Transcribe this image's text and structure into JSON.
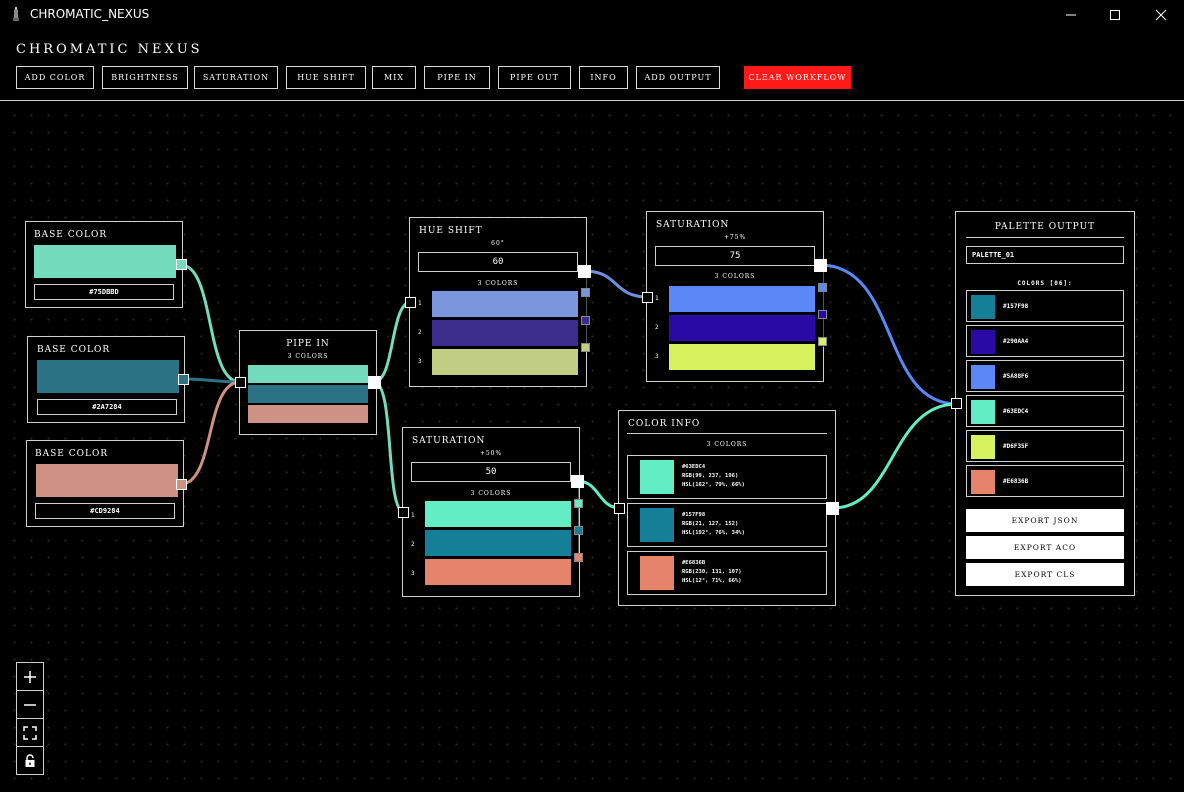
{
  "window": {
    "title": "CHROMATIC_NEXUS"
  },
  "app": {
    "brand": "CHROMATIC NEXUS"
  },
  "toolbar": {
    "add_color": "ADD COLOR",
    "brightness": "BRIGHTNESS",
    "saturation": "SATURATION",
    "hue_shift": "HUE SHIFT",
    "mix": "MIX",
    "pipe_in": "PIPE IN",
    "pipe_out": "PIPE OUT",
    "info": "INFO",
    "add_output": "ADD OUTPUT",
    "clear_workflow": "CLEAR WORKFLOW"
  },
  "colors": {
    "danger": "#ff1a1a",
    "wire_teal": "#63e0b8",
    "wire_blue": "#5a7ee0",
    "wire_pink": "#d58a80"
  },
  "nodes": {
    "base1": {
      "title": "BASE COLOR",
      "hex": "#75DBBD",
      "color": "#75dbbd"
    },
    "base2": {
      "title": "BASE COLOR",
      "hex": "#2A7284",
      "color": "#2a7284"
    },
    "base3": {
      "title": "BASE COLOR",
      "hex": "#CD9284",
      "color": "#cd9284"
    },
    "pipe_in": {
      "title": "PIPE IN",
      "sub": "3 COLORS",
      "swatches": [
        "#75dbbd",
        "#2a7284",
        "#cd9284"
      ]
    },
    "hue": {
      "title": "HUE SHIFT",
      "amount": "60°",
      "value": "60",
      "count": "3 COLORS",
      "rows": [
        {
          "n": "1",
          "color": "#7b95de"
        },
        {
          "n": "2",
          "color": "#3c2d8c"
        },
        {
          "n": "3",
          "color": "#c2cd84"
        }
      ]
    },
    "sat_top": {
      "title": "SATURATION",
      "amount": "+75%",
      "value": "75",
      "count": "3 COLORS",
      "rows": [
        {
          "n": "1",
          "color": "#5a88f6"
        },
        {
          "n": "2",
          "color": "#290aa4"
        },
        {
          "n": "3",
          "color": "#d6f35f"
        }
      ]
    },
    "sat_bot": {
      "title": "SATURATION",
      "amount": "+50%",
      "value": "50",
      "count": "3 COLORS",
      "rows": [
        {
          "n": "1",
          "color": "#63edc4"
        },
        {
          "n": "2",
          "color": "#157f98"
        },
        {
          "n": "3",
          "color": "#e6836b"
        }
      ]
    },
    "info": {
      "title": "COLOR INFO",
      "count": "3 COLORS",
      "rows": [
        {
          "color": "#63edc4",
          "hex": "#63EDC4",
          "rgb": "RGB(99, 237, 196)",
          "hsl": "HSL(162°, 79%, 66%)"
        },
        {
          "color": "#157f98",
          "hex": "#157F98",
          "rgb": "RGB(21, 127, 152)",
          "hsl": "HSL(192°, 76%, 34%)"
        },
        {
          "color": "#e6836b",
          "hex": "#E6836B",
          "rgb": "RGB(230, 131, 107)",
          "hsl": "HSL(12°, 71%, 66%)"
        }
      ]
    },
    "output": {
      "title": "PALETTE OUTPUT",
      "name": "PALETTE_01",
      "count_label": "COLORS [06]:",
      "rows": [
        {
          "color": "#157f98",
          "hex": "#157F98"
        },
        {
          "color": "#290aa4",
          "hex": "#290AA4"
        },
        {
          "color": "#5a88f6",
          "hex": "#5A88F6"
        },
        {
          "color": "#63edc4",
          "hex": "#63EDC4"
        },
        {
          "color": "#d6f35f",
          "hex": "#D6F35F"
        },
        {
          "color": "#e6836b",
          "hex": "#E6836B"
        }
      ],
      "export_json": "EXPORT JSON",
      "export_aco": "EXPORT ACO",
      "export_cls": "EXPORT CLS"
    }
  },
  "zoom_controls": {
    "zoom_in_icon": "plus-icon",
    "zoom_out_icon": "minus-icon",
    "fit_icon": "fit-view-icon",
    "lock_icon": "lock-icon"
  }
}
